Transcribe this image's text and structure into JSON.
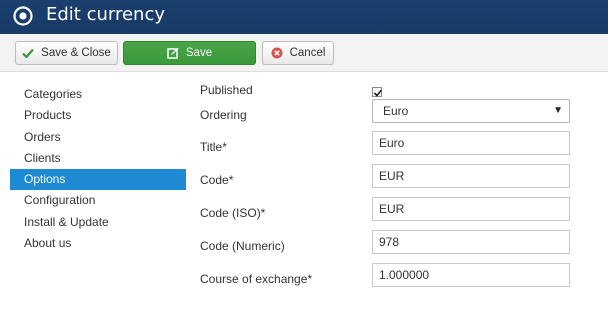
{
  "header": {
    "title": "Edit currency"
  },
  "toolbar": {
    "save_close_label": "Save & Close",
    "save_label": "Save",
    "cancel_label": "Cancel"
  },
  "sidebar": {
    "items": [
      {
        "label": "Categories"
      },
      {
        "label": "Products"
      },
      {
        "label": "Orders"
      },
      {
        "label": "Clients"
      },
      {
        "label": "Options",
        "active": true
      },
      {
        "label": "Configuration"
      },
      {
        "label": "Install & Update"
      },
      {
        "label": "About us"
      }
    ]
  },
  "form": {
    "published": {
      "label": "Published",
      "checked": true
    },
    "ordering": {
      "label": "Ordering",
      "value": "Euro"
    },
    "title": {
      "label": "Title*",
      "value": "Euro"
    },
    "code": {
      "label": "Code*",
      "value": "EUR"
    },
    "code_iso": {
      "label": "Code (ISO)*",
      "value": "EUR"
    },
    "code_numeric": {
      "label": "Code (Numeric)",
      "value": "978"
    },
    "course": {
      "label": "Course of exchange*",
      "value": "1.000000"
    }
  },
  "colors": {
    "header_bg": "#1b3f6e",
    "save_button": "#47a447",
    "active_sidebar": "#1d8ad3",
    "cancel_icon": "#d9534f"
  },
  "icons": {
    "logo": "joomla-target-icon",
    "save_close": "check-icon",
    "save": "edit-icon",
    "cancel": "cancel-circle-icon"
  }
}
